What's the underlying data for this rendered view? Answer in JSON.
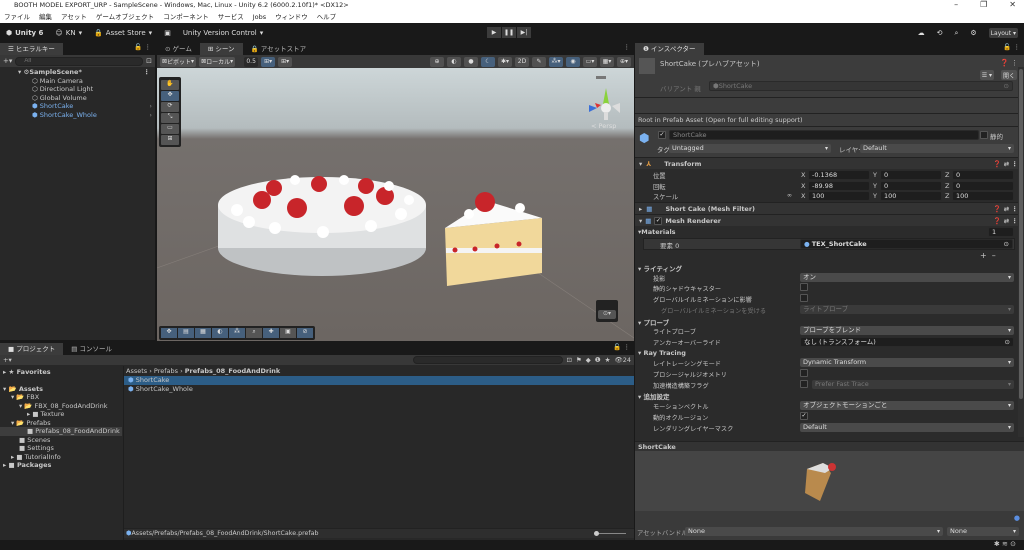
{
  "window": {
    "title": "BOOTH MODEL EXPORT_URP - SampleScene - Windows, Mac, Linux - Unity 6.2 (6000.2.10f1)* <DX12>"
  },
  "menu": [
    "ファイル",
    "編集",
    "アセット",
    "ゲームオブジェクト",
    "コンポーネント",
    "サービス",
    "Jobs",
    "ウィンドウ",
    "ヘルプ"
  ],
  "toolbar": {
    "unity": "Unity 6",
    "account": "KN",
    "asset_store": "Asset Store",
    "version_control": "Unity Version Control",
    "layout": "Layout"
  },
  "hierarchy": {
    "tab": "ヒエラルキー",
    "search_placeholder": "All",
    "scene": "SampleScene*",
    "items": [
      "Main Camera",
      "Directional Light",
      "Global Volume",
      "ShortCake",
      "ShortCake_Whole"
    ]
  },
  "scene": {
    "tabs": [
      "ゲーム",
      "シーン",
      "アセットストア"
    ],
    "pivot": "ピボット",
    "local": "ローカル",
    "snap": "0.5",
    "persp": "< Persp"
  },
  "project": {
    "tabs": [
      "プロジェクト",
      "コンソール"
    ],
    "count": "24",
    "favorites": "Favorites",
    "tree": [
      "Assets",
      "FBX",
      "FBX_08_FoodAndDrink",
      "Texture",
      "Prefabs",
      "Prefabs_08_FoodAndDrink",
      "Scenes",
      "Settings",
      "TutorialInfo",
      "Packages"
    ],
    "breadcrumb": [
      "Assets",
      "Prefabs",
      "Prefabs_08_FoodAndDrink"
    ],
    "files": [
      "ShortCake",
      "ShortCake_Whole"
    ],
    "path": "Assets/Prefabs/Prefabs_08_FoodAndDrink/ShortCake.prefab"
  },
  "inspector": {
    "tab": "インスペクター",
    "title": "ShortCake (プレハブアセット)",
    "open": "開く",
    "variant_label": "バリアント 親",
    "variant_value": "ShortCake",
    "root_note": "Root in Prefab Asset (Open for full editing support)",
    "name": "ShortCake",
    "static": "静的",
    "tag_label": "タグ",
    "tag": "Untagged",
    "layer_label": "レイヤー",
    "layer": "Default",
    "transform": {
      "title": "Transform",
      "pos_label": "位置",
      "rot_label": "回転",
      "scale_label": "スケール",
      "pos": [
        "-0.1368",
        "0",
        "0"
      ],
      "rot": [
        "-89.98",
        "0",
        "0"
      ],
      "scale": [
        "100",
        "100",
        "100"
      ]
    },
    "mesh_filter": "Short Cake (Mesh Filter)",
    "mesh_renderer": "Mesh Renderer",
    "materials": {
      "label": "Materials",
      "count": "1",
      "element": "要素 0",
      "value": "TEX_ShortCake"
    },
    "lighting": {
      "label": "ライティング",
      "cast": "投影",
      "cast_value": "オン",
      "static_shadow": "静的シャドウキャスター",
      "gi": "グローバルイルミネーションに影響",
      "gi_receive": "グローバルイルミネーションを受ける",
      "gi_receive_value": "ライトプローブ"
    },
    "probes": {
      "label": "プローブ",
      "light_probe": "ライトプローブ",
      "light_probe_value": "プローブをブレンド",
      "anchor": "アンカーオーバーライド",
      "anchor_value": "なし (トランスフォーム)"
    },
    "ray": {
      "label": "Ray Tracing",
      "mode": "レイトレーシングモード",
      "mode_value": "Dynamic Transform",
      "procedural": "プロシージャルジオメトリ",
      "accel": "加速構造構築フラグ",
      "accel_value": "Prefer Fast Trace"
    },
    "additional": {
      "label": "追加設定",
      "motion": "モーションベクトル",
      "motion_value": "オブジェクトモーションごと",
      "occlusion": "動的オクルージョン",
      "mask": "レンダリングレイヤーマスク",
      "mask_value": "Default"
    },
    "preview_title": "ShortCake",
    "bundle_label": "アセットバンドル",
    "bundle": "None",
    "variant": "None"
  },
  "colors": {
    "accent": "#46607c",
    "selection": "#2c5d87",
    "prefab": "#7bb2f0"
  }
}
